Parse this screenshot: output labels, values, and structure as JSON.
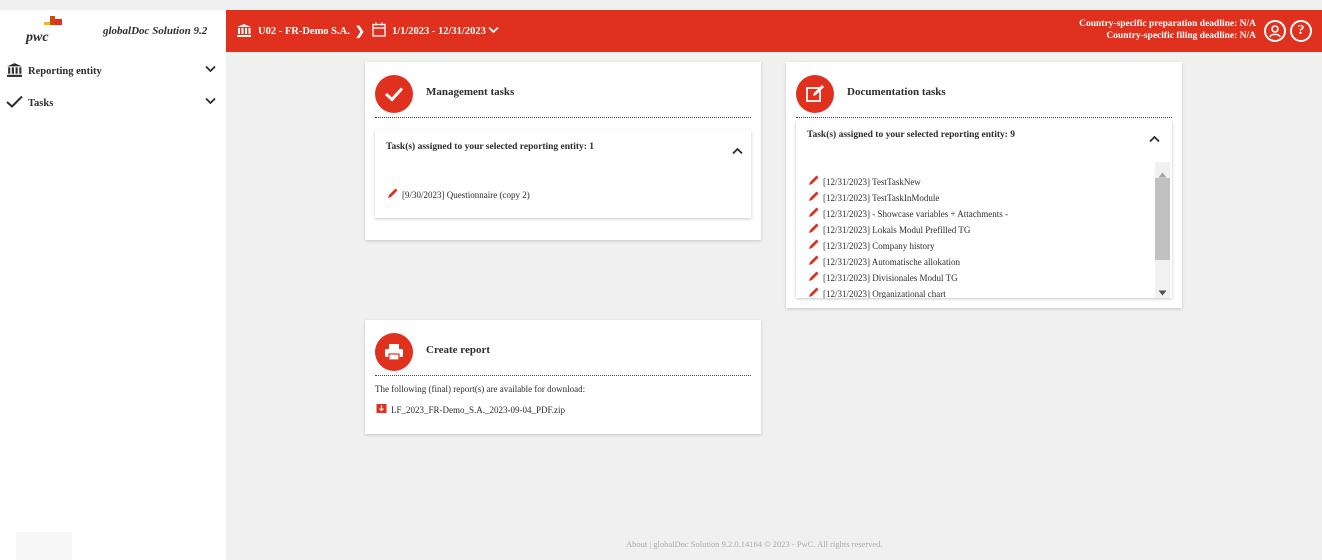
{
  "brand": {
    "logo_text": "pwc",
    "app_name": "globalDoc Solution 9.2"
  },
  "topbar": {
    "entity": "U02 - FR-Demo S.A.",
    "period": "1/1/2023 - 12/31/2023",
    "preparation_deadline": "Country-specific preparation deadline: N/A",
    "filing_deadline": "Country-specific filing deadline: N/A",
    "user_icon": "user-circle-icon",
    "help_icon": "help-circle-icon",
    "help_glyph": "?",
    "colors": {
      "accent": "#e0301e"
    }
  },
  "sidebar": {
    "items": [
      {
        "label": "Reporting entity",
        "icon": "bank-icon"
      },
      {
        "label": "Tasks",
        "icon": "check-icon"
      }
    ]
  },
  "management": {
    "title": "Management tasks",
    "panel_header": "Task(s) assigned to your selected reporting entity: 1",
    "tasks": [
      "[9/30/2023] Questionnaire (copy 2)"
    ]
  },
  "documentation": {
    "title": "Documentation tasks",
    "panel_header": "Task(s) assigned to your selected reporting entity: 9",
    "tasks": [
      "[12/31/2023] TestTaskNew",
      "[12/31/2023] TestTaskInModule",
      "[12/31/2023] - Showcase variables + Attachments -",
      "[12/31/2023] Lokals Modul Prefilled TG",
      "[12/31/2023] Company history",
      "[12/31/2023] Automatische allokation",
      "[12/31/2023] Divisionales Modul TG",
      "[12/31/2023] Organizational chart"
    ]
  },
  "report": {
    "title": "Create report",
    "description": "The following (final) report(s) are available for download:",
    "file": "LF_2023_FR-Demo_S.A._2023-09-04_PDF.zip"
  },
  "footer": {
    "text": "About | globalDoc Solution 9.2.0.14164 © 2023 - PwC. All rights reserved."
  }
}
